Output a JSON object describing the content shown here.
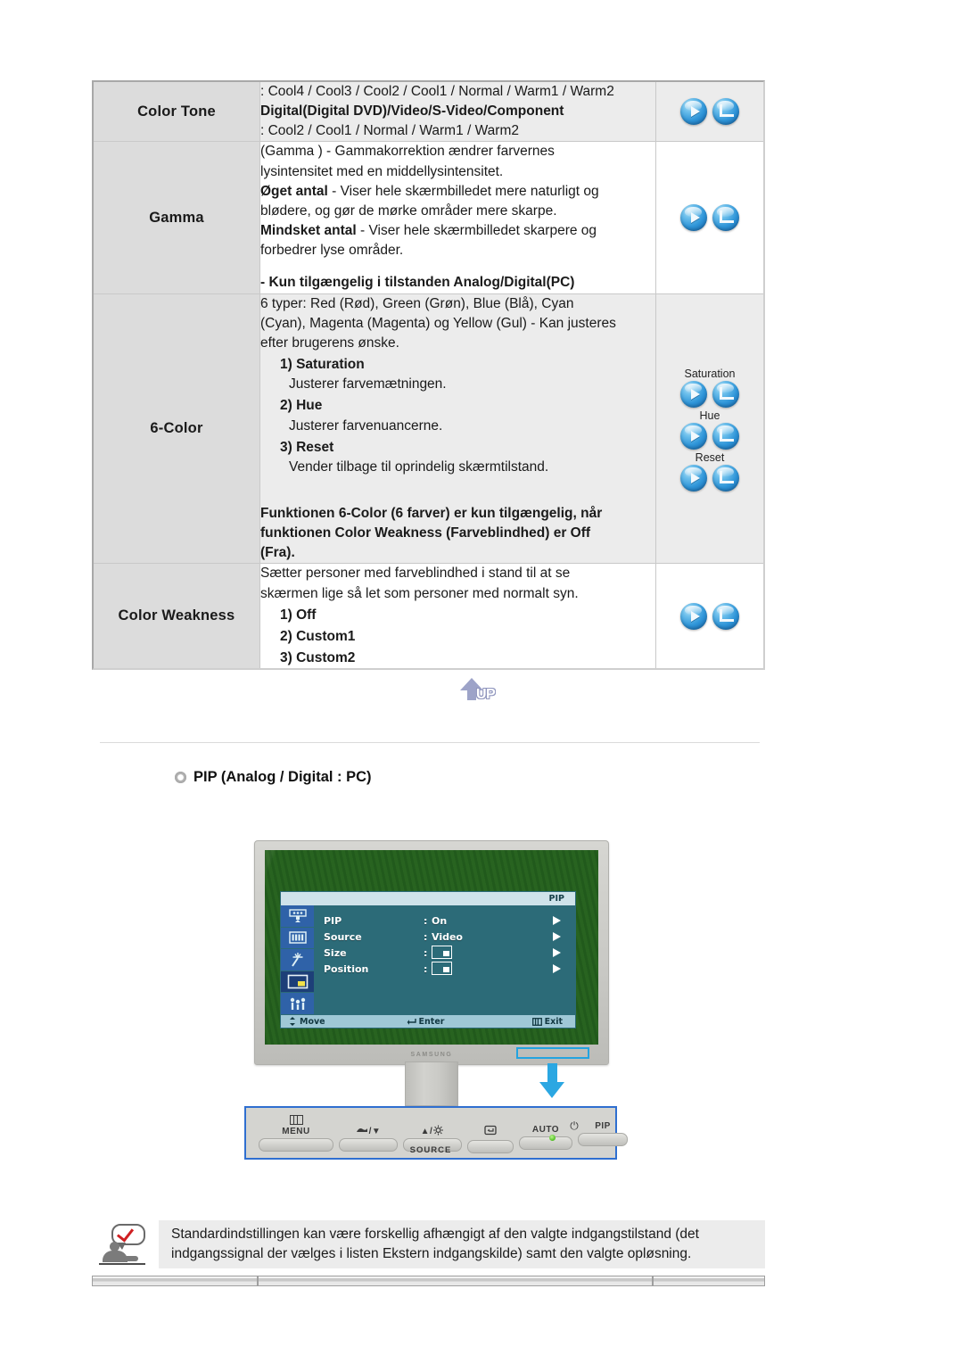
{
  "spec_table": {
    "rows": [
      {
        "label": "Color Tone",
        "shade": true,
        "lines": [
          {
            "t": ": Cool4 / Cool3 / Cool2 / Cool1 / Normal / Warm1 / Warm2",
            "style": "normal"
          },
          {
            "t": "Digital(Digital DVD)/Video/S-Video/Component",
            "style": "bold"
          },
          {
            "t": ": Cool2 / Cool1 / Normal / Warm1 / Warm2",
            "style": "normal"
          }
        ],
        "buttons": [
          {
            "label": "",
            "icons": [
              "play-icon",
              "enter-icon"
            ]
          }
        ]
      },
      {
        "label": "Gamma",
        "shade": false,
        "lines": [
          {
            "t": "(Gamma ) - Gammakorrektion ændrer farvernes",
            "style": "normal"
          },
          {
            "t": "lysintensitet med en middellysintensitet.",
            "style": "normal"
          },
          {
            "t": "Øget antal",
            "style": "bold-inline",
            "rest": " - Viser hele skærmbilledet mere naturligt og"
          },
          {
            "t": "blødere, og gør de mørke områder mere skarpe.",
            "style": "normal"
          },
          {
            "t": "Mindsket antal",
            "style": "bold-inline",
            "rest": " - Viser hele skærmbilledet skarpere og"
          },
          {
            "t": "forbedrer lyse områder.",
            "style": "normal"
          },
          {
            "t": "",
            "style": "gap"
          },
          {
            "t": "- Kun tilgængelig i tilstanden Analog/Digital(PC)",
            "style": "bold"
          }
        ],
        "buttons": [
          {
            "label": "",
            "icons": [
              "play-icon",
              "enter-icon"
            ]
          }
        ]
      },
      {
        "label": "6-Color",
        "shade": true,
        "lines": [
          {
            "t": "6 typer: Red (Rød), Green (Grøn), Blue (Blå), Cyan",
            "style": "normal"
          },
          {
            "t": "(Cyan), Magenta (Magenta) og Yellow (Gul) - Kan justeres",
            "style": "normal"
          },
          {
            "t": "efter brugerens ønske.",
            "style": "normal"
          },
          {
            "t": "1) Saturation",
            "style": "indent-bold"
          },
          {
            "t": "Justerer farvemætningen.",
            "style": "indent2"
          },
          {
            "t": "2) Hue",
            "style": "indent-bold"
          },
          {
            "t": "Justerer farvenuancerne.",
            "style": "indent2"
          },
          {
            "t": "3) Reset",
            "style": "indent-bold"
          },
          {
            "t": "Vender tilbage til oprindelig skærmtilstand.",
            "style": "indent2"
          },
          {
            "t": "",
            "style": "gap-lg"
          },
          {
            "t": "Funktionen 6-Color (6 farver) er kun tilgængelig, når",
            "style": "bold"
          },
          {
            "t": "funktionen Color Weakness (Farveblindhed) er Off",
            "style": "bold"
          },
          {
            "t": "(Fra).",
            "style": "bold"
          }
        ],
        "buttons": [
          {
            "label": "Saturation",
            "icons": [
              "play-icon",
              "enter-icon"
            ]
          },
          {
            "label": "Hue",
            "icons": [
              "play-icon",
              "enter-icon"
            ]
          },
          {
            "label": "Reset",
            "icons": [
              "play-icon",
              "enter-icon"
            ]
          }
        ]
      },
      {
        "label": "Color Weakness",
        "shade": false,
        "lines": [
          {
            "t": "Sætter personer med farveblindhed i stand til at se",
            "style": "normal"
          },
          {
            "t": "skærmen lige så let som personer med normalt syn.",
            "style": "normal"
          },
          {
            "t": "1) Off",
            "style": "indent-bold"
          },
          {
            "t": "2) Custom1",
            "style": "indent-bold"
          },
          {
            "t": "3) Custom2",
            "style": "indent-bold"
          }
        ],
        "buttons": [
          {
            "label": "",
            "icons": [
              "play-icon",
              "enter-icon"
            ]
          }
        ]
      }
    ]
  },
  "up_button": {
    "label": "UP"
  },
  "pip_section": {
    "heading": "PIP (Analog / Digital : PC)",
    "osd": {
      "title": "PIP",
      "items": [
        {
          "name": "PIP",
          "colon": ":",
          "value": "On",
          "value_type": "text"
        },
        {
          "name": "Source",
          "colon": ":",
          "value": "Video",
          "value_type": "text"
        },
        {
          "name": "Size",
          "colon": ":",
          "value": "",
          "value_type": "box"
        },
        {
          "name": "Position",
          "colon": ":",
          "value": "",
          "value_type": "box"
        }
      ],
      "footer": {
        "move": "Move",
        "enter": "Enter",
        "exit": "Exit"
      },
      "side_icons": [
        "image-setup-icon",
        "color-icon",
        "magic-icon",
        "pip-icon",
        "setup-icon"
      ]
    },
    "monitor": {
      "brand": "SAMSUNG"
    },
    "control_panel": {
      "buttons": [
        {
          "label": "MENU",
          "icon": "menu-icon"
        },
        {
          "label": "/▼",
          "icon": "source-down-icon"
        },
        {
          "label": "▲/",
          "icon": "brightness-up-icon"
        },
        {
          "label": "",
          "icon": "enter-source-icon"
        },
        {
          "label": "AUTO",
          "icon": ""
        },
        {
          "label": "PIP",
          "icon": ""
        }
      ],
      "source_label": "SOURCE",
      "power": {
        "symbol": "⏻",
        "led_color": "#4fbe22"
      }
    }
  },
  "bottom_note": {
    "icon": "note-person-icon",
    "line1": "Standardindstillingen kan være forskellig afhængigt af den valgte indgangstilstand (det",
    "line2": "indgangssignal der vælges i listen Ekstern indgangskilde) samt den valgte opløsning."
  },
  "colors": {
    "accent_blue": "#2f95d8",
    "highlight_cyan": "#23a3e0",
    "osd_teal": "#2c6b78",
    "osd_side_blue": "#2f62a8",
    "shade_gray": "#ececec",
    "label_gray": "#dcdcdc"
  }
}
